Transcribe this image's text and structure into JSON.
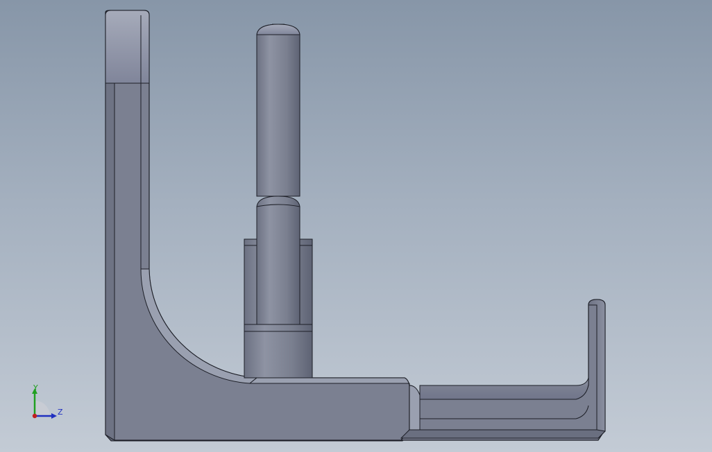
{
  "viewport": {
    "background_top": "#8796a8",
    "background_bottom": "#c3cbd5"
  },
  "model": {
    "face_color": "#7a7f90",
    "edge_color": "#1c1e26",
    "highlight_color": "#9aa0b0"
  },
  "triad": {
    "y_label": "Y",
    "z_label": "Z",
    "y_color": "#20a020",
    "z_color": "#2030c0",
    "x_color": "#c02020"
  }
}
